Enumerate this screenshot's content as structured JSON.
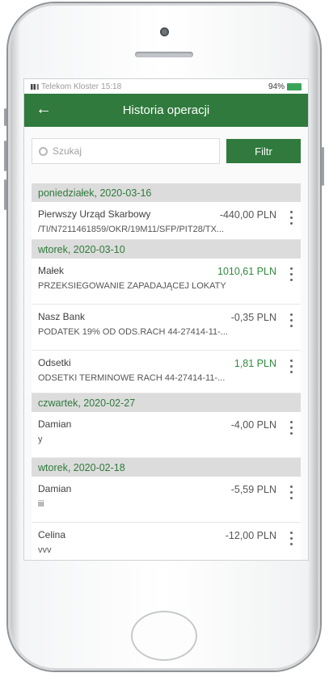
{
  "status": {
    "carrier": "Telekom Kloster",
    "time": "15:18",
    "battery": "94%"
  },
  "header": {
    "title": "Historia operacji",
    "back_label": "←"
  },
  "search": {
    "placeholder": "Szukaj",
    "filter_label": "Filtr"
  },
  "groups": [
    {
      "date": "poniedziałek, 2020-03-16",
      "items": [
        {
          "name": "Pierwszy Urząd Skarbowy",
          "amount": "-440,00 PLN",
          "positive": false,
          "desc": "/TI/N7211461859/OKR/19M11/SFP/PIT28/TX..."
        }
      ]
    },
    {
      "date": "wtorek, 2020-03-10",
      "items": [
        {
          "name": "Małek",
          "amount": "1010,61 PLN",
          "positive": true,
          "desc": "PRZEKSIEGOWANIE ZAPADAJĄCEJ LOKATY"
        },
        {
          "name": "Nasz Bank",
          "amount": "-0,35 PLN",
          "positive": false,
          "desc": "PODATEK 19% OD ODS.RACH 44-27414-11-..."
        },
        {
          "name": "Odsetki",
          "amount": "1,81 PLN",
          "positive": true,
          "desc": "ODSETKI TERMINOWE RACH 44-27414-11-..."
        }
      ]
    },
    {
      "date": "czwartek, 2020-02-27",
      "items": [
        {
          "name": "Damian",
          "amount": "-4,00 PLN",
          "positive": false,
          "desc": "y"
        }
      ]
    },
    {
      "date": "wtorek, 2020-02-18",
      "items": [
        {
          "name": "Damian",
          "amount": "-5,59 PLN",
          "positive": false,
          "desc": "iii"
        },
        {
          "name": "Celina",
          "amount": "-12,00 PLN",
          "positive": false,
          "desc": "vvv"
        }
      ]
    }
  ],
  "colors": {
    "brand": "#2f7a3c",
    "positive_amount": "#2f8a3e",
    "date_bar": "#dcdcdc"
  }
}
